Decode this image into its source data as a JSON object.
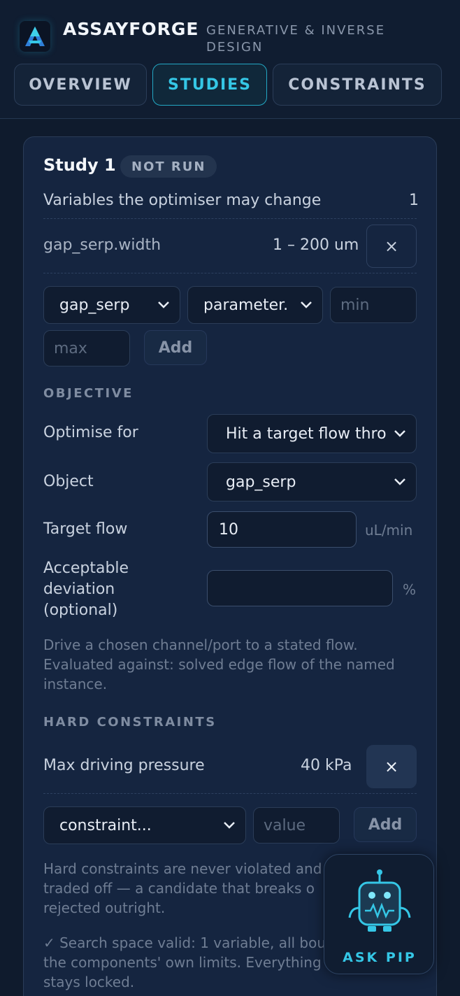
{
  "app": {
    "name": "ASSAYFORGE",
    "tagline": "GENERATIVE & INVERSE DESIGN"
  },
  "tabs": [
    {
      "label": "OVERVIEW",
      "active": false
    },
    {
      "label": "STUDIES",
      "active": true
    },
    {
      "label": "CONSTRAINTS",
      "active": false
    }
  ],
  "study": {
    "title": "Study 1",
    "status": "NOT RUN",
    "variables_label": "Variables the optimiser may change",
    "variables_count": "1",
    "variable": {
      "name": "gap_serp.width",
      "range": "1 – 200 um",
      "remove": "×"
    },
    "add_variable": {
      "object": "gap_serp",
      "parameter": "parameter.",
      "min_placeholder": "min",
      "max_placeholder": "max",
      "add_label": "Add"
    },
    "objective": {
      "heading": "OBJECTIVE",
      "optimise_label": "Optimise for",
      "optimise_value": "Hit a target flow thro",
      "object_label": "Object",
      "object_value": "gap_serp",
      "target_label": "Target flow",
      "target_value": "10",
      "target_unit": "uL/min",
      "deviation_label_1": "Acceptable",
      "deviation_label_2": "deviation",
      "deviation_label_3": "(optional)",
      "deviation_unit": "%",
      "help_1": "Drive a chosen channel/port to a stated flow.",
      "help_2": "Evaluated against: solved edge flow of the named",
      "help_3": "instance."
    },
    "constraints": {
      "heading": "HARD CONSTRAINTS",
      "item_label": "Max driving pressure",
      "item_value": "40 kPa",
      "remove": "×",
      "select_value": "constraint...",
      "value_placeholder": "value",
      "add_label": "Add",
      "help_1": "Hard constraints are never violated and",
      "help_2": "traded off — a candidate that breaks o",
      "help_3": "rejected outright.",
      "valid_1": "✓ Search space valid: 1 variable, all bou",
      "valid_2": "the components' own limits. Everything",
      "valid_3": "stays locked."
    }
  },
  "assistant": {
    "label": "ASK PIP",
    "icon": "robot-icon"
  },
  "colors": {
    "accent": "#35c7e6",
    "background": "#0f1b2d",
    "card": "#152540"
  }
}
